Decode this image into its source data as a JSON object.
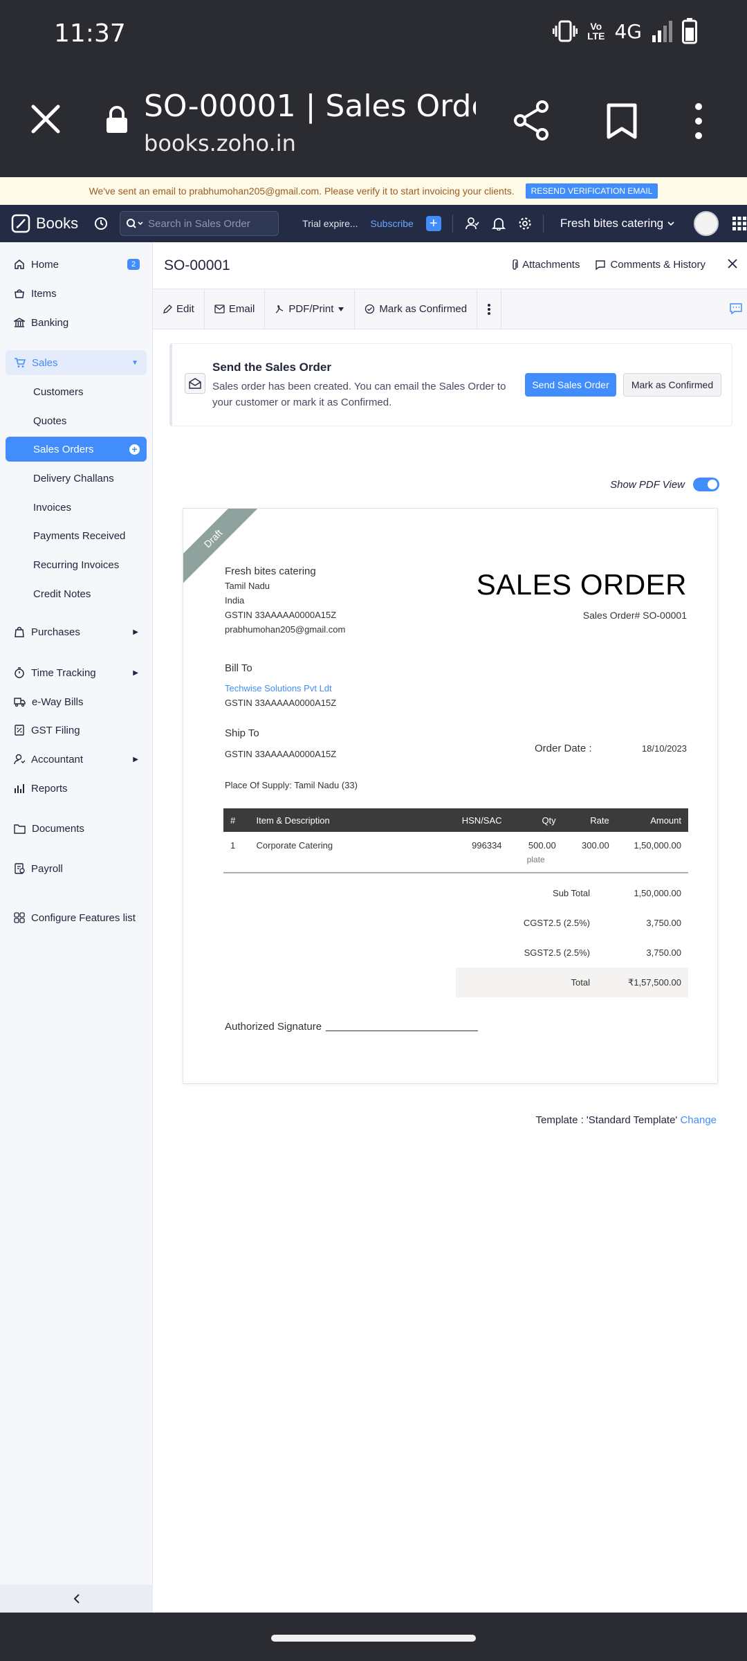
{
  "status_bar": {
    "time": "11:37",
    "network": "4G",
    "volte_line1": "Vo",
    "volte_line2": "LTE"
  },
  "browser": {
    "title": "SO-00001 | Sales Orde…",
    "url": "books.zoho.in"
  },
  "banner": {
    "message": "We've sent an email to prabhumohan205@gmail.com. Please verify it to start invoicing your clients.",
    "resend_label": "RESEND VERIFICATION EMAIL"
  },
  "navbar": {
    "app_name": "Books",
    "search_placeholder": "Search in Sales Order",
    "trial": "Trial expire...",
    "subscribe": "Subscribe",
    "org_name": "Fresh bites catering"
  },
  "sidebar": {
    "home": "Home",
    "home_badge": "2",
    "items": "Items",
    "banking": "Banking",
    "sales": "Sales",
    "customers": "Customers",
    "quotes": "Quotes",
    "sales_orders": "Sales Orders",
    "delivery_challans": "Delivery Challans",
    "invoices": "Invoices",
    "payments_received": "Payments Received",
    "recurring_invoices": "Recurring Invoices",
    "credit_notes": "Credit Notes",
    "purchases": "Purchases",
    "time_tracking": "Time Tracking",
    "eway_bills": "e-Way Bills",
    "gst_filing": "GST Filing",
    "accountant": "Accountant",
    "reports": "Reports",
    "documents": "Documents",
    "payroll": "Payroll",
    "configure": "Configure Features list"
  },
  "header": {
    "title": "SO-00001",
    "attachments": "Attachments",
    "comments": "Comments & History"
  },
  "toolbar": {
    "edit": "Edit",
    "email": "Email",
    "pdf_print": "PDF/Print",
    "mark_confirmed": "Mark as Confirmed"
  },
  "send_card": {
    "title": "Send the Sales Order",
    "description": "Sales order has been created. You can email the Sales Order to your customer or mark it as Confirmed.",
    "send_label": "Send Sales Order",
    "confirm_label": "Mark as Confirmed"
  },
  "pdf_view": {
    "label": "Show PDF View",
    "enabled": true
  },
  "document": {
    "ribbon": "Draft",
    "from_org": "Fresh bites catering",
    "from_state": "Tamil Nadu",
    "from_country": "India",
    "from_gstin": "GSTIN 33AAAAA0000A15Z",
    "from_email": "prabhumohan205@gmail.com",
    "heading": "SALES ORDER",
    "so_number": "Sales Order# SO-00001",
    "bill_to_label": "Bill To",
    "bill_to_name": "Techwise Solutions Pvt Ldt",
    "bill_to_gstin": "GSTIN 33AAAAA0000A15Z",
    "ship_to_label": "Ship To",
    "ship_to_gstin": "GSTIN 33AAAAA0000A15Z",
    "order_date_label": "Order Date :",
    "order_date": "18/10/2023",
    "place_of_supply": "Place Of Supply: Tamil Nadu (33)",
    "columns": {
      "num": "#",
      "item": "Item & Description",
      "hsn": "HSN/SAC",
      "qty": "Qty",
      "rate": "Rate",
      "amount": "Amount"
    },
    "line_item": {
      "num": "1",
      "item": "Corporate Catering",
      "hsn": "996334",
      "qty": "500.00",
      "unit": "plate",
      "rate": "300.00",
      "amount": "1,50,000.00"
    },
    "subtotal_label": "Sub Total",
    "subtotal": "1,50,000.00",
    "cgst_label": "CGST2.5 (2.5%)",
    "cgst": "3,750.00",
    "sgst_label": "SGST2.5 (2.5%)",
    "sgst": "3,750.00",
    "total_label": "Total",
    "total": "₹1,57,500.00",
    "signature_label": "Authorized Signature"
  },
  "template": {
    "label": "Template : 'Standard Template'",
    "change": "Change"
  },
  "colors": {
    "accent": "#408dfb",
    "navbar": "#232b45",
    "sidebar": "#f6f7fb",
    "ribbon": "#90a29e"
  }
}
